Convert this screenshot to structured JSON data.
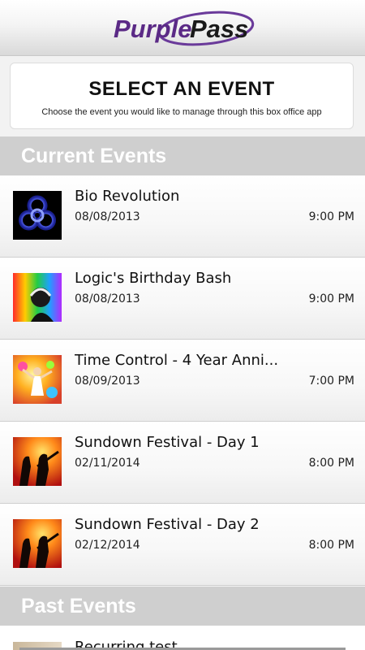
{
  "app": {
    "logo_text": "PurplePass",
    "brand_color": "#5b2a86"
  },
  "select": {
    "title": "SELECT AN EVENT",
    "subtitle": "Choose the event you would like to manage through this box office app"
  },
  "sections": {
    "current_title": "Current Events",
    "past_title": "Past Events"
  },
  "current_events": [
    {
      "name": "Bio Revolution",
      "date": "08/08/2013",
      "time": "9:00 PM",
      "thumb": "biohazard-icon"
    },
    {
      "name": "Logic's Birthday Bash",
      "date": "08/08/2013",
      "time": "9:00 PM",
      "thumb": "dj-rainbow-image"
    },
    {
      "name": "Time Control - 4 Year Anni...",
      "date": "08/09/2013",
      "time": "7:00 PM",
      "thumb": "colorful-dancer-image"
    },
    {
      "name": "Sundown Festival - Day 1",
      "date": "02/11/2014",
      "time": "8:00 PM",
      "thumb": "sunset-guitarist-image"
    },
    {
      "name": "Sundown Festival - Day 2",
      "date": "02/12/2014",
      "time": "8:00 PM",
      "thumb": "sunset-guitarist-image"
    }
  ],
  "past_events": [
    {
      "name": "Recurring test"
    }
  ]
}
